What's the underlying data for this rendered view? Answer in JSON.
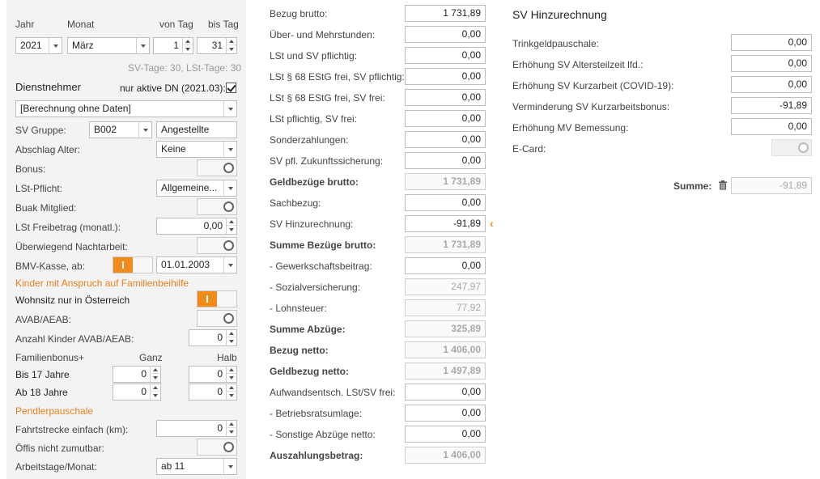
{
  "period": {
    "year_label": "Jahr",
    "month_label": "Monat",
    "from_day_label": "von Tag",
    "to_day_label": "bis Tag",
    "year": "2021",
    "month": "März",
    "from_day": "1",
    "to_day": "31",
    "days_info": "SV-Tage: 30,  LSt-Tage: 30"
  },
  "employee": {
    "heading": "Dienstnehmer",
    "active_only_label": "nur aktive DN (2021.03):",
    "active_only_checked": true,
    "selector": "[Berechnung ohne Daten]"
  },
  "fields": {
    "sv_gruppe_label": "SV Gruppe:",
    "sv_gruppe_code": "B002",
    "sv_gruppe_text": "Angestellte",
    "abschlag_alter_label": "Abschlag Alter:",
    "abschlag_alter": "Keine",
    "bonus_label": "Bonus:",
    "lst_pflicht_label": "LSt-Pflicht:",
    "lst_pflicht": "Allgemeine...",
    "buak_label": "Buak Mitglied:",
    "lst_freibetrag_label": "LSt Freibetrag (monatl.):",
    "lst_freibetrag": "0,00",
    "nachtarbeit_label": "Überwiegend Nachtarbeit:",
    "bmv_label": "BMV-Kasse, ab:",
    "bmv_date": "01.01.2003"
  },
  "children": {
    "heading": "Kinder mit Anspruch auf Familienbeihilfe",
    "wohnsitz_label": "Wohnsitz nur in Österreich",
    "avab_label": "AVAB/AEAB:",
    "anzahl_label": "Anzahl Kinder AVAB/AEAB:",
    "anzahl": "0",
    "familienbonus_label": "Familienbonus+",
    "ganz_label": "Ganz",
    "halb_label": "Halb",
    "bis17_label": "Bis 17 Jahre",
    "bis17_ganz": "0",
    "bis17_halb": "0",
    "ab18_label": "Ab 18 Jahre",
    "ab18_ganz": "0",
    "ab18_halb": "0"
  },
  "commuter": {
    "heading": "Pendlerpauschale",
    "fahrtstrecke_label": "Fahrtstrecke einfach (km):",
    "fahrtstrecke": "0",
    "oeffis_label": "Öffis nicht zumutbar:",
    "arbeitstage_label": "Arbeitstage/Monat:",
    "arbeitstage": "ab 11"
  },
  "salary": {
    "rows": [
      {
        "label": "Bezug brutto:",
        "value": "1 731,89"
      },
      {
        "label": "Über- und Mehrstunden:",
        "value": "0,00"
      },
      {
        "label": "LSt und SV pflichtig:",
        "value": "0,00"
      },
      {
        "label": "LSt § 68 EStG frei, SV pflichtig:",
        "value": "0,00"
      },
      {
        "label": "LSt § 68 EStG frei, SV frei:",
        "value": "0,00"
      },
      {
        "label": "LSt pflichtig, SV frei:",
        "value": "0,00"
      },
      {
        "label": "Sonderzahlungen:",
        "value": "0,00"
      },
      {
        "label": "SV pfl. Zukunftssicherung:",
        "value": "0,00"
      },
      {
        "label": "Geldbezüge brutto:",
        "value": "1 731,89"
      },
      {
        "label": "Sachbezug:",
        "value": "0,00"
      },
      {
        "label": "SV Hinzurechnung:",
        "value": "-91,89"
      },
      {
        "label": "Summe Bezüge brutto:",
        "value": "1 731,89"
      },
      {
        "label": "- Gewerkschaftsbeitrag:",
        "value": "0,00"
      },
      {
        "label": "- Sozialversicherung:",
        "value": "247,97"
      },
      {
        "label": "- Lohnsteuer:",
        "value": "77,92"
      },
      {
        "label": "Summe Abzüge:",
        "value": "325,89"
      },
      {
        "label": "Bezug netto:",
        "value": "1 406,00"
      },
      {
        "label": "Geldbezug netto:",
        "value": "1 497,89"
      },
      {
        "label": "Aufwandsentsch. LSt/SV frei:",
        "value": "0,00"
      },
      {
        "label": "- Betriebsratsumlage:",
        "value": "0,00"
      },
      {
        "label": "- Sonstige Abzüge netto:",
        "value": "0,00"
      },
      {
        "label": "Auszahlungsbetrag:",
        "value": "1 406,00"
      }
    ]
  },
  "sv_add": {
    "title": "SV Hinzurechnung",
    "rows": [
      {
        "label": "Trinkgeldpauschale:",
        "value": "0,00"
      },
      {
        "label": "Erhöhung SV Altersteilzeit lfd.:",
        "value": "0,00"
      },
      {
        "label": "Erhöhung SV Kurzarbeit (COVID-19):",
        "value": "0,00"
      },
      {
        "label": "Verminderung SV Kurzarbeitsbonus:",
        "value": "-91,89"
      },
      {
        "label": "Erhöhung MV Bemessung:",
        "value": "0,00"
      }
    ],
    "ecard_label": "E-Card:",
    "sum_label": "Summe:",
    "sum_value": "-91,89"
  },
  "icons": {
    "marker": "chevron-left-icon",
    "trash": "trash-icon"
  },
  "colors": {
    "accent": "#f08a1a"
  }
}
